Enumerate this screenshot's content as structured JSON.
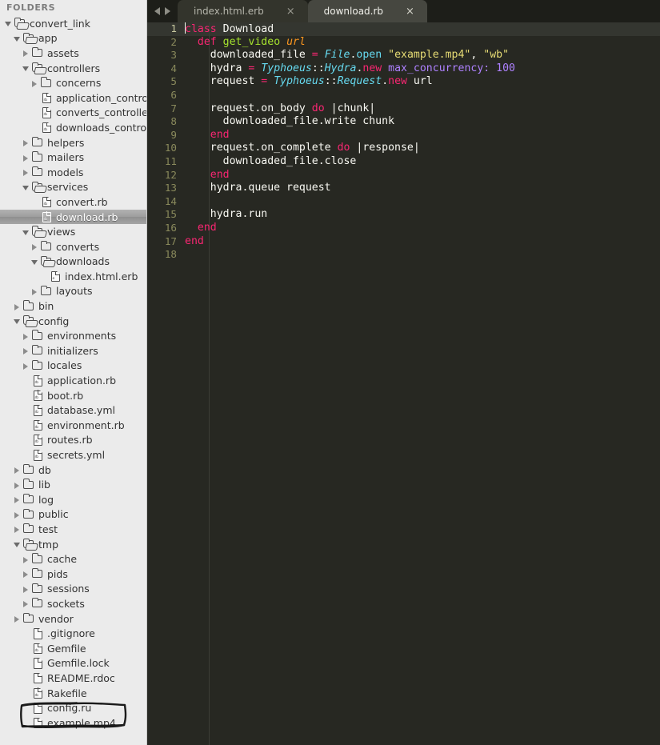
{
  "sidebar": {
    "title": "FOLDERS",
    "items": [
      {
        "label": "convert_link",
        "depth": 0,
        "type": "folder",
        "state": "expanded"
      },
      {
        "label": "app",
        "depth": 1,
        "type": "folder",
        "state": "expanded"
      },
      {
        "label": "assets",
        "depth": 2,
        "type": "folder",
        "state": "collapsed"
      },
      {
        "label": "controllers",
        "depth": 2,
        "type": "folder",
        "state": "expanded"
      },
      {
        "label": "concerns",
        "depth": 3,
        "type": "folder",
        "state": "collapsed"
      },
      {
        "label": "application_controller.rb",
        "depth": 3,
        "type": "file",
        "icon": "ruby-file-icon"
      },
      {
        "label": "converts_controller.rb",
        "depth": 3,
        "type": "file",
        "icon": "ruby-file-icon"
      },
      {
        "label": "downloads_controller.rb",
        "depth": 3,
        "type": "file",
        "icon": "ruby-file-icon"
      },
      {
        "label": "helpers",
        "depth": 2,
        "type": "folder",
        "state": "collapsed"
      },
      {
        "label": "mailers",
        "depth": 2,
        "type": "folder",
        "state": "collapsed"
      },
      {
        "label": "models",
        "depth": 2,
        "type": "folder",
        "state": "collapsed"
      },
      {
        "label": "services",
        "depth": 2,
        "type": "folder",
        "state": "expanded"
      },
      {
        "label": "convert.rb",
        "depth": 3,
        "type": "file",
        "icon": "ruby-file-icon"
      },
      {
        "label": "download.rb",
        "depth": 3,
        "type": "file",
        "icon": "ruby-file-icon",
        "selected": true
      },
      {
        "label": "views",
        "depth": 2,
        "type": "folder",
        "state": "expanded"
      },
      {
        "label": "converts",
        "depth": 3,
        "type": "folder",
        "state": "collapsed"
      },
      {
        "label": "downloads",
        "depth": 3,
        "type": "folder",
        "state": "expanded"
      },
      {
        "label": "index.html.erb",
        "depth": 4,
        "type": "file",
        "icon": "erb-file-icon"
      },
      {
        "label": "layouts",
        "depth": 3,
        "type": "folder",
        "state": "collapsed"
      },
      {
        "label": "bin",
        "depth": 1,
        "type": "folder",
        "state": "collapsed"
      },
      {
        "label": "config",
        "depth": 1,
        "type": "folder",
        "state": "expanded"
      },
      {
        "label": "environments",
        "depth": 2,
        "type": "folder",
        "state": "collapsed"
      },
      {
        "label": "initializers",
        "depth": 2,
        "type": "folder",
        "state": "collapsed"
      },
      {
        "label": "locales",
        "depth": 2,
        "type": "folder",
        "state": "collapsed"
      },
      {
        "label": "application.rb",
        "depth": 2,
        "type": "file",
        "icon": "ruby-file-icon"
      },
      {
        "label": "boot.rb",
        "depth": 2,
        "type": "file",
        "icon": "ruby-file-icon"
      },
      {
        "label": "database.yml",
        "depth": 2,
        "type": "file",
        "icon": "ruby-file-icon"
      },
      {
        "label": "environment.rb",
        "depth": 2,
        "type": "file",
        "icon": "ruby-file-icon"
      },
      {
        "label": "routes.rb",
        "depth": 2,
        "type": "file",
        "icon": "ruby-file-icon"
      },
      {
        "label": "secrets.yml",
        "depth": 2,
        "type": "file",
        "icon": "ruby-file-icon"
      },
      {
        "label": "db",
        "depth": 1,
        "type": "folder",
        "state": "collapsed"
      },
      {
        "label": "lib",
        "depth": 1,
        "type": "folder",
        "state": "collapsed"
      },
      {
        "label": "log",
        "depth": 1,
        "type": "folder",
        "state": "collapsed"
      },
      {
        "label": "public",
        "depth": 1,
        "type": "folder",
        "state": "collapsed"
      },
      {
        "label": "test",
        "depth": 1,
        "type": "folder",
        "state": "collapsed"
      },
      {
        "label": "tmp",
        "depth": 1,
        "type": "folder",
        "state": "expanded"
      },
      {
        "label": "cache",
        "depth": 2,
        "type": "folder",
        "state": "collapsed"
      },
      {
        "label": "pids",
        "depth": 2,
        "type": "folder",
        "state": "collapsed"
      },
      {
        "label": "sessions",
        "depth": 2,
        "type": "folder",
        "state": "collapsed"
      },
      {
        "label": "sockets",
        "depth": 2,
        "type": "folder",
        "state": "collapsed"
      },
      {
        "label": "vendor",
        "depth": 1,
        "type": "folder",
        "state": "collapsed"
      },
      {
        "label": ".gitignore",
        "depth": 2,
        "type": "file",
        "icon": "plain-file-icon"
      },
      {
        "label": "Gemfile",
        "depth": 2,
        "type": "file",
        "icon": "ruby-file-icon"
      },
      {
        "label": "Gemfile.lock",
        "depth": 2,
        "type": "file",
        "icon": "plain-file-icon"
      },
      {
        "label": "README.rdoc",
        "depth": 2,
        "type": "file",
        "icon": "plain-file-icon"
      },
      {
        "label": "Rakefile",
        "depth": 2,
        "type": "file",
        "icon": "ruby-file-icon"
      },
      {
        "label": "config.ru",
        "depth": 2,
        "type": "file",
        "icon": "plain-file-icon"
      },
      {
        "label": "example.mp4",
        "depth": 2,
        "type": "file",
        "icon": "plain-file-icon",
        "annotated": true
      }
    ]
  },
  "tabbar": {
    "prev_label": "◀",
    "next_label": "▶",
    "close_label": "×",
    "tabs": [
      {
        "label": "index.html.erb",
        "active": false
      },
      {
        "label": "download.rb",
        "active": true
      }
    ]
  },
  "editor": {
    "active_line": 1,
    "line_numbers": [
      1,
      2,
      3,
      4,
      5,
      6,
      7,
      8,
      9,
      10,
      11,
      12,
      13,
      14,
      15,
      16,
      17,
      18
    ],
    "lines": [
      {
        "n": 1,
        "text": "class Download"
      },
      {
        "n": 2,
        "text": "  def get_video url"
      },
      {
        "n": 3,
        "text": "    downloaded_file = File.open \"example.mp4\", \"wb\""
      },
      {
        "n": 4,
        "text": "    hydra = Typhoeus::Hydra.new max_concurrency: 100"
      },
      {
        "n": 5,
        "text": "    request = Typhoeus::Request.new url"
      },
      {
        "n": 6,
        "text": ""
      },
      {
        "n": 7,
        "text": "    request.on_body do |chunk|"
      },
      {
        "n": 8,
        "text": "      downloaded_file.write chunk"
      },
      {
        "n": 9,
        "text": "    end"
      },
      {
        "n": 10,
        "text": "    request.on_complete do |response|"
      },
      {
        "n": 11,
        "text": "      downloaded_file.close"
      },
      {
        "n": 12,
        "text": "    end"
      },
      {
        "n": 13,
        "text": "    hydra.queue request"
      },
      {
        "n": 14,
        "text": ""
      },
      {
        "n": 15,
        "text": "    hydra.run"
      },
      {
        "n": 16,
        "text": "  end"
      },
      {
        "n": 17,
        "text": "end"
      },
      {
        "n": 18,
        "text": ""
      }
    ],
    "tokens": [
      [
        {
          "t": "class",
          "c": "kw"
        },
        {
          "t": " ",
          "c": "plain"
        },
        {
          "t": "Download",
          "c": "plain"
        }
      ],
      [
        {
          "t": "  ",
          "c": "plain"
        },
        {
          "t": "def",
          "c": "kw"
        },
        {
          "t": " ",
          "c": "plain"
        },
        {
          "t": "get_video",
          "c": "fn"
        },
        {
          "t": " ",
          "c": "plain"
        },
        {
          "t": "url",
          "c": "param"
        }
      ],
      [
        {
          "t": "    downloaded_file ",
          "c": "plain"
        },
        {
          "t": "=",
          "c": "op"
        },
        {
          "t": " ",
          "c": "plain"
        },
        {
          "t": "File",
          "c": "const"
        },
        {
          "t": ".",
          "c": "punct"
        },
        {
          "t": "open",
          "c": "meth"
        },
        {
          "t": " ",
          "c": "plain"
        },
        {
          "t": "\"example.mp4\"",
          "c": "str"
        },
        {
          "t": ", ",
          "c": "plain"
        },
        {
          "t": "\"wb\"",
          "c": "str"
        }
      ],
      [
        {
          "t": "    hydra ",
          "c": "plain"
        },
        {
          "t": "=",
          "c": "op"
        },
        {
          "t": " ",
          "c": "plain"
        },
        {
          "t": "Typhoeus",
          "c": "const"
        },
        {
          "t": "::",
          "c": "punct"
        },
        {
          "t": "Hydra",
          "c": "const"
        },
        {
          "t": ".",
          "c": "punct"
        },
        {
          "t": "new",
          "c": "kw"
        },
        {
          "t": " ",
          "c": "plain"
        },
        {
          "t": "max_concurrency:",
          "c": "sym"
        },
        {
          "t": " ",
          "c": "plain"
        },
        {
          "t": "100",
          "c": "num"
        }
      ],
      [
        {
          "t": "    request ",
          "c": "plain"
        },
        {
          "t": "=",
          "c": "op"
        },
        {
          "t": " ",
          "c": "plain"
        },
        {
          "t": "Typhoeus",
          "c": "const"
        },
        {
          "t": "::",
          "c": "punct"
        },
        {
          "t": "Request",
          "c": "const"
        },
        {
          "t": ".",
          "c": "punct"
        },
        {
          "t": "new",
          "c": "kw"
        },
        {
          "t": " ",
          "c": "plain"
        },
        {
          "t": "url",
          "c": "plain"
        }
      ],
      [],
      [
        {
          "t": "    request.on_body ",
          "c": "plain"
        },
        {
          "t": "do",
          "c": "kw"
        },
        {
          "t": " |chunk|",
          "c": "plain"
        }
      ],
      [
        {
          "t": "      downloaded_file.write chunk",
          "c": "plain"
        }
      ],
      [
        {
          "t": "    ",
          "c": "plain"
        },
        {
          "t": "end",
          "c": "kw"
        }
      ],
      [
        {
          "t": "    request.on_complete ",
          "c": "plain"
        },
        {
          "t": "do",
          "c": "kw"
        },
        {
          "t": " |response|",
          "c": "plain"
        }
      ],
      [
        {
          "t": "      downloaded_file.close",
          "c": "plain"
        }
      ],
      [
        {
          "t": "    ",
          "c": "plain"
        },
        {
          "t": "end",
          "c": "kw"
        }
      ],
      [
        {
          "t": "    hydra.queue request",
          "c": "plain"
        }
      ],
      [],
      [
        {
          "t": "    hydra.run",
          "c": "plain"
        }
      ],
      [
        {
          "t": "  ",
          "c": "plain"
        },
        {
          "t": "end",
          "c": "kw"
        }
      ],
      [
        {
          "t": "end",
          "c": "kw"
        }
      ],
      []
    ]
  },
  "colors": {
    "editor_bg": "#272822",
    "active_line_bg": "#343630",
    "tabbar_bg": "#1d1e19",
    "tab_active_bg": "#464740",
    "tab_inactive_bg": "#33342c",
    "sidebar_bg": "#ebebeb",
    "selection_bg": "#9d9d9d",
    "keyword": "#f92672",
    "string": "#e6db74",
    "constant": "#66d9ef",
    "number": "#ae81ff",
    "function": "#a6e22e",
    "parameter": "#fd971f",
    "plain_text": "#f8f8f2",
    "line_number": "#8a8a5c"
  }
}
